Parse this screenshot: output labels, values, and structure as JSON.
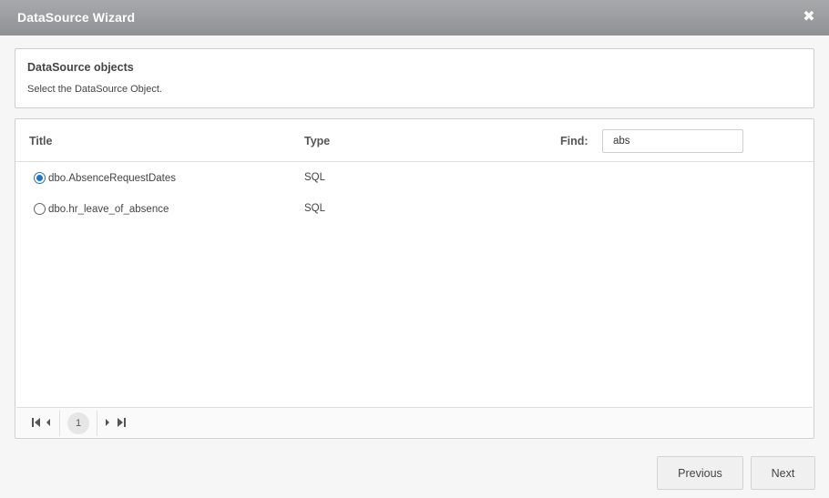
{
  "window": {
    "title": "DataSource Wizard",
    "close_icon": "close-icon"
  },
  "info": {
    "heading": "DataSource objects",
    "description": "Select the DataSource Object."
  },
  "grid": {
    "columns": {
      "title": "Title",
      "type": "Type"
    },
    "find": {
      "label": "Find:",
      "value": "abs"
    },
    "rows": [
      {
        "name": "dbo.AbsenceRequestDates",
        "type": "SQL",
        "selected": true
      },
      {
        "name": "dbo.hr_leave_of_absence",
        "type": "SQL",
        "selected": false
      }
    ],
    "pager": {
      "current_page": "1",
      "icons": [
        "first-page-icon",
        "previous-page-icon",
        "next-page-icon",
        "last-page-icon"
      ]
    }
  },
  "footer": {
    "previous_label": "Previous",
    "next_label": "Next"
  },
  "colors": {
    "titlebar": "#9a9c9f",
    "accent": "#1f73c8",
    "background": "#f6f6f6"
  }
}
